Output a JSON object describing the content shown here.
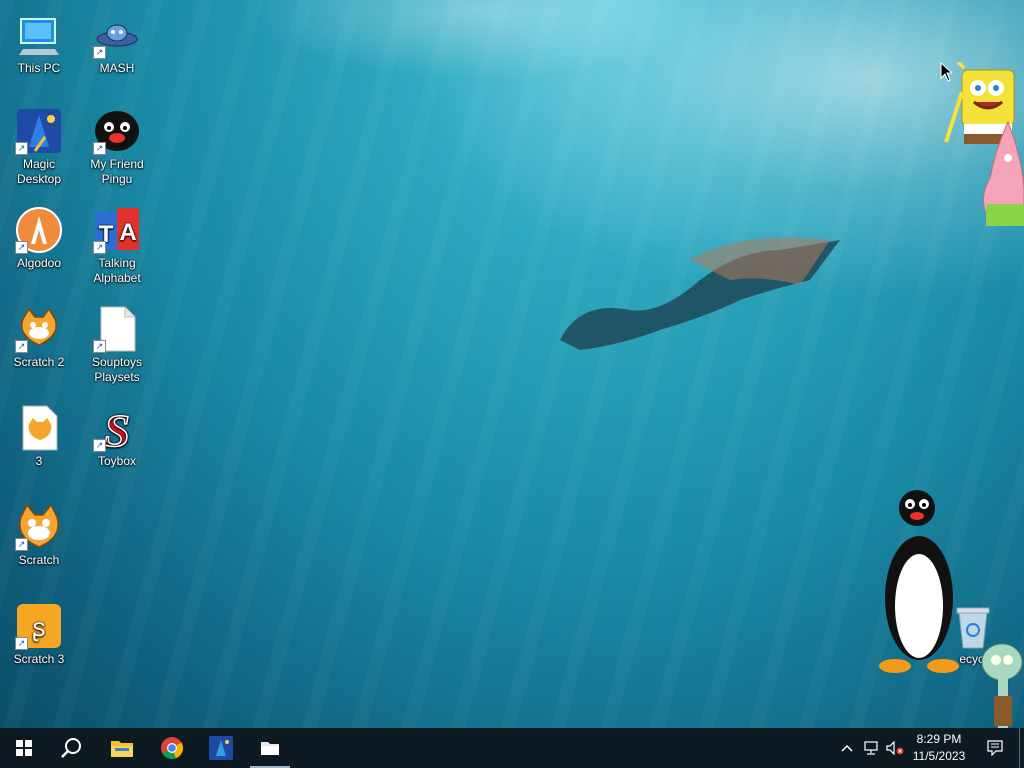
{
  "desktop": {
    "icons": [
      {
        "label": "This PC"
      },
      {
        "label": "MASH"
      },
      {
        "label": "Magic Desktop"
      },
      {
        "label": "My Friend Pingu"
      },
      {
        "label": "Algodoo"
      },
      {
        "label": "Talking Alphabet"
      },
      {
        "label": "Scratch 2"
      },
      {
        "label": "Souptoys Playsets"
      },
      {
        "label": "3"
      },
      {
        "label": "Toybox"
      },
      {
        "label": "Scratch"
      },
      {
        "label": "Scratch 3"
      },
      {
        "label": "Recycle Bin",
        "visible_text": "ecycl"
      }
    ]
  },
  "taskbar": {
    "items": [
      {
        "name": "Start",
        "icon": "windows-logo-icon"
      },
      {
        "name": "Search",
        "icon": "search-icon"
      },
      {
        "name": "File Explorer",
        "icon": "folder-icon"
      },
      {
        "name": "Google Chrome",
        "icon": "chrome-icon"
      },
      {
        "name": "Magic Desktop",
        "icon": "magic-desktop-icon"
      },
      {
        "name": "Open window",
        "icon": "window-app-icon",
        "active": true
      }
    ],
    "tray": {
      "icons": [
        "chevron-up-icon",
        "network-icon",
        "volume-muted-icon",
        "notification-icon"
      ],
      "time": "8:29 PM",
      "date": "11/5/2023"
    }
  },
  "colors": {
    "taskbar": "#0e1a22",
    "water_top": "#57c6da",
    "water_bottom": "#0c4f69"
  }
}
